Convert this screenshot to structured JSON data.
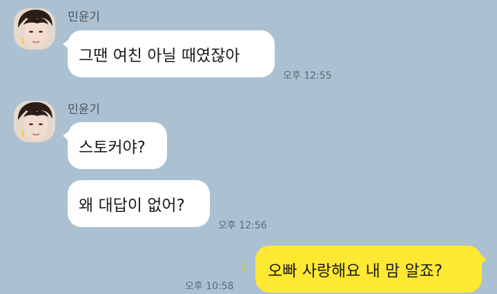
{
  "colors": {
    "background": "#abc1d1",
    "bubble_other": "#ffffff",
    "bubble_mine": "#fde932",
    "time_text": "#5b6a76",
    "unread_count": "#e7c700"
  },
  "messages": [
    {
      "group": 1,
      "sender": "민윤기",
      "avatar_icon": "profile-photo-avatar",
      "bubbles": [
        "그땐 여친 아닐 때였잖아"
      ],
      "time": "오후 12:55"
    },
    {
      "group": 2,
      "sender": "민윤기",
      "avatar_icon": "profile-photo-avatar",
      "bubbles": [
        "스토커야?",
        "왜 대답이 없어?"
      ],
      "time": "오후 12:56"
    },
    {
      "group": 3,
      "mine": true,
      "bubbles": [
        "오빠 사랑해요 내 맘 알죠?"
      ],
      "unread": "1",
      "time": "오후 10:58"
    }
  ]
}
